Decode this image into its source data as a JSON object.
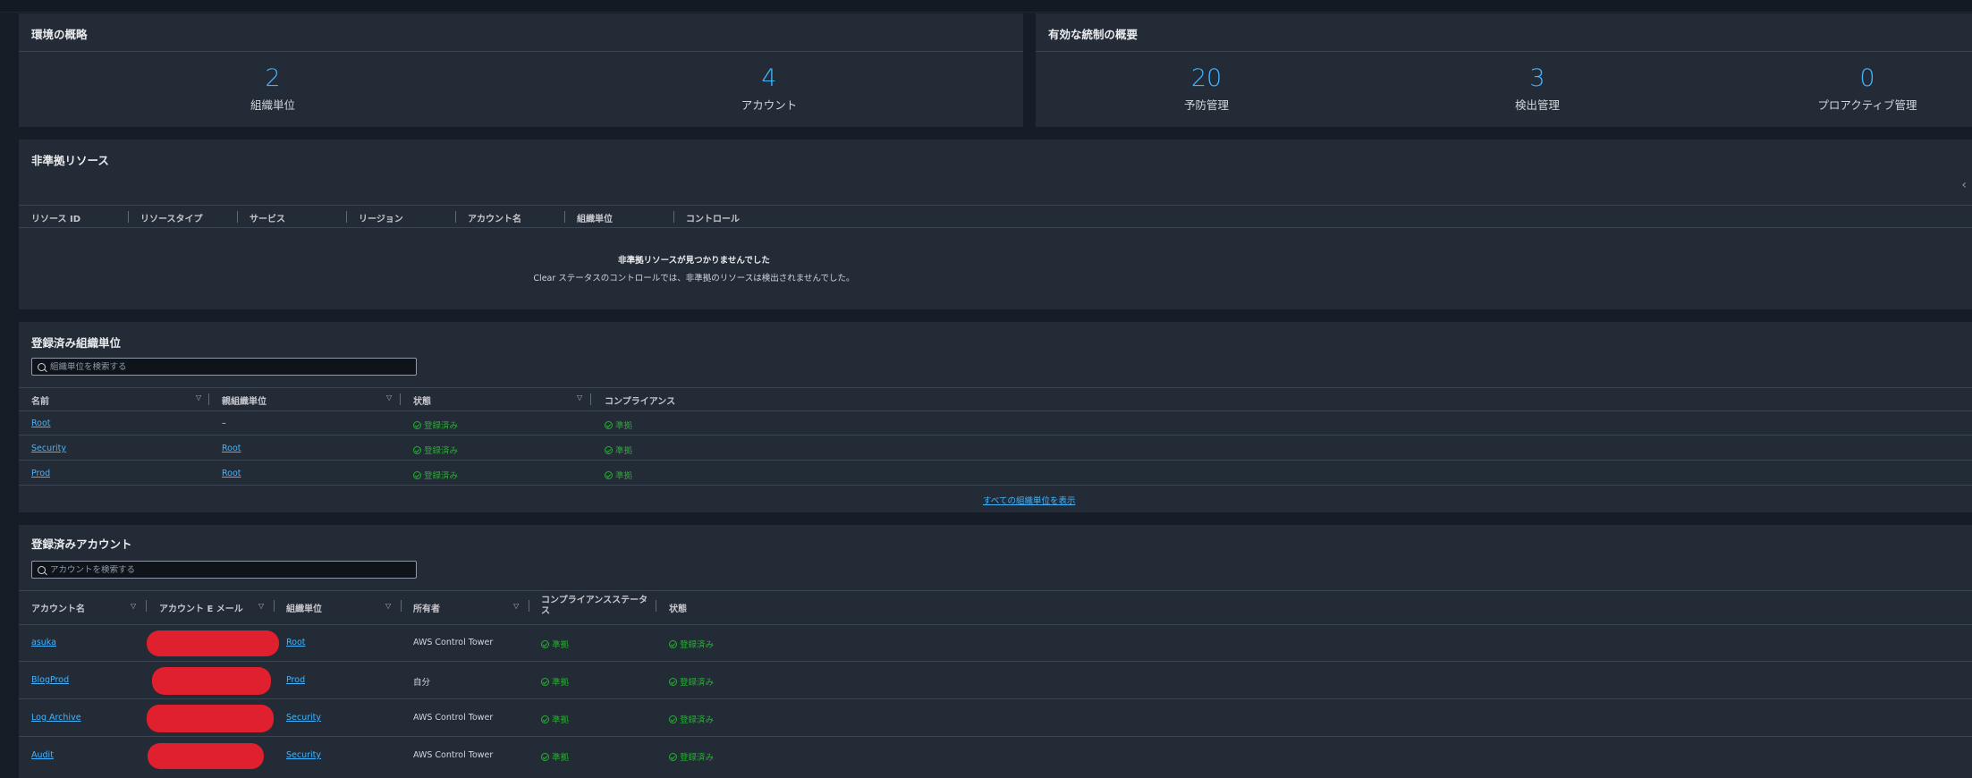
{
  "environment": {
    "title": "環境の概略",
    "stats": [
      {
        "value": "2",
        "label": "組織単位"
      },
      {
        "value": "4",
        "label": "アカウント"
      }
    ]
  },
  "controls": {
    "title": "有効な統制の概要",
    "stats": [
      {
        "value": "20",
        "label": "予防管理"
      },
      {
        "value": "3",
        "label": "検出管理"
      },
      {
        "value": "0",
        "label": "プロアクティブ管理"
      }
    ]
  },
  "noncompliant": {
    "title": "非準拠リソース",
    "columns": [
      "リソース ID",
      "リソースタイプ",
      "サービス",
      "リージョン",
      "アカウント名",
      "組織単位",
      "コントロール"
    ],
    "empty_title": "非準拠リソースが見つかりませんでした",
    "empty_desc": "Clear ステータスのコントロールでは、非準拠のリソースは検出されませんでした。",
    "chevron": "chevron-left-icon"
  },
  "ous": {
    "title": "登録済み組織単位",
    "search_placeholder": "組織単位を検索する",
    "columns": [
      "名前",
      "親組織単位",
      "状態",
      "コンプライアンス"
    ],
    "rows": [
      {
        "name": "Root",
        "parent": "–",
        "state": "登録済み",
        "compliance": "準拠"
      },
      {
        "name": "Security",
        "parent": "Root",
        "state": "登録済み",
        "compliance": "準拠"
      },
      {
        "name": "Prod",
        "parent": "Root",
        "state": "登録済み",
        "compliance": "準拠"
      }
    ],
    "view_all": "すべての組織単位を表示"
  },
  "accounts": {
    "title": "登録済みアカウント",
    "search_placeholder": "アカウントを検索する",
    "columns": [
      "アカウント名",
      "アカウント E メール",
      "組織単位",
      "所有者",
      "コンプライアンスステータス",
      "状態"
    ],
    "rows": [
      {
        "name": "asuka",
        "ou": "Root",
        "owner": "AWS Control Tower",
        "compliance": "準拠",
        "state": "登録済み"
      },
      {
        "name": "BlogProd",
        "ou": "Prod",
        "owner": "自分",
        "compliance": "準拠",
        "state": "登録済み"
      },
      {
        "name": "Log Archive",
        "ou": "Security",
        "owner": "AWS Control Tower",
        "compliance": "準拠",
        "state": "登録済み"
      },
      {
        "name": "Audit",
        "ou": "Security",
        "owner": "AWS Control Tower",
        "compliance": "準拠",
        "state": "登録済み"
      }
    ]
  },
  "colors": {
    "accent": "#42b4ff",
    "success": "#29ad32",
    "panel": "#232b37",
    "background": "#161d26",
    "redaction": "#e0202e"
  }
}
